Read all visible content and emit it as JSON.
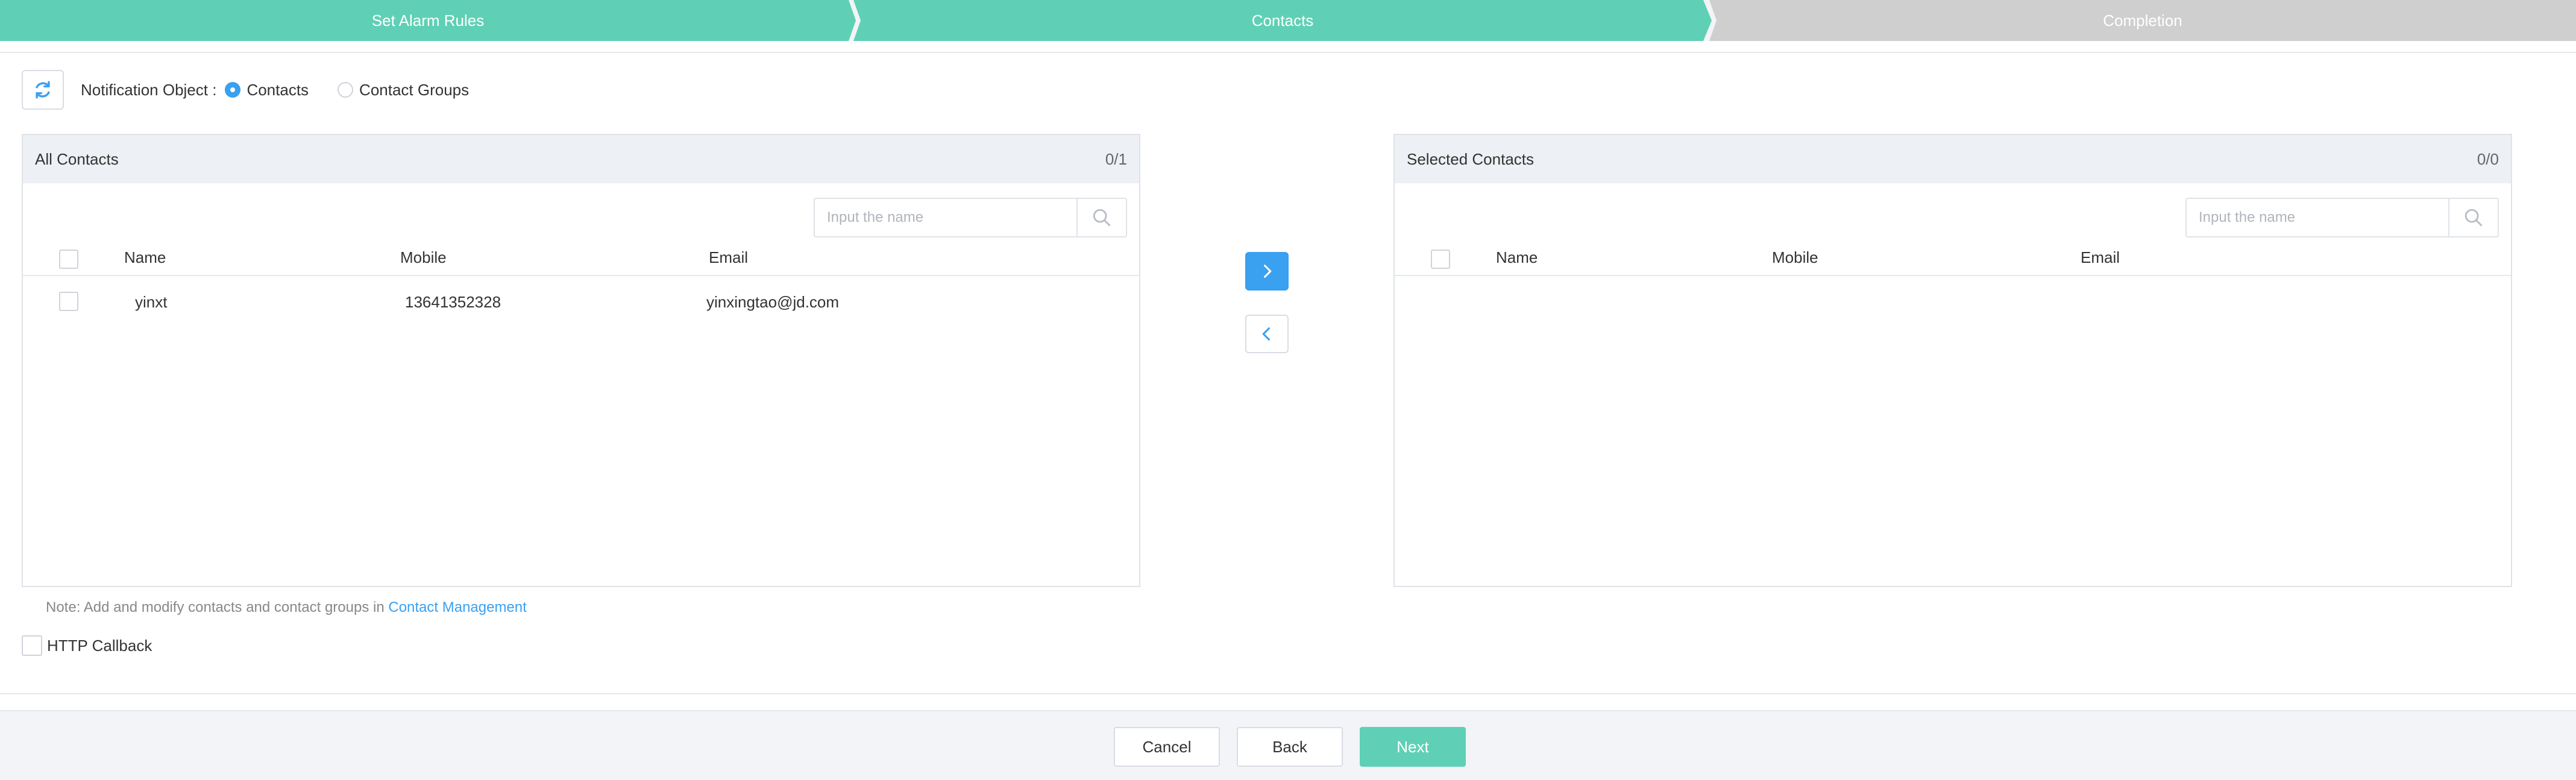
{
  "steps": [
    {
      "label": "Set Alarm Rules",
      "state": "done"
    },
    {
      "label": "Contacts",
      "state": "active"
    },
    {
      "label": "Completion",
      "state": "pending"
    }
  ],
  "colors": {
    "accent": "#3aa0f0",
    "step_active": "#5fd0b5",
    "step_pending": "#cfcfcf",
    "next_button": "#5fd0b5"
  },
  "notification": {
    "label": "Notification Object :",
    "options": [
      {
        "label": "Contacts",
        "selected": true
      },
      {
        "label": "Contact Groups",
        "selected": false
      }
    ]
  },
  "refresh_icon": "refresh-icon",
  "all_contacts": {
    "title": "All Contacts",
    "count": "0/1",
    "search_placeholder": "Input the name",
    "columns": [
      "Name",
      "Mobile",
      "Email"
    ],
    "rows": [
      {
        "name": "yinxt",
        "mobile": "13641352328",
        "email": "yinxingtao@jd.com",
        "checked": false
      }
    ]
  },
  "selected_contacts": {
    "title": "Selected Contacts",
    "count": "0/0",
    "search_placeholder": "Input the name",
    "columns": [
      "Name",
      "Mobile",
      "Email"
    ],
    "rows": []
  },
  "transfer": {
    "to_right_icon": "chevron-right-icon",
    "to_left_icon": "chevron-left-icon"
  },
  "note": {
    "text": "Note: Add and modify contacts and contact groups in",
    "link": "Contact Management"
  },
  "http_callback": {
    "label": "HTTP Callback",
    "checked": false
  },
  "footer": {
    "cancel": "Cancel",
    "back": "Back",
    "next": "Next"
  }
}
